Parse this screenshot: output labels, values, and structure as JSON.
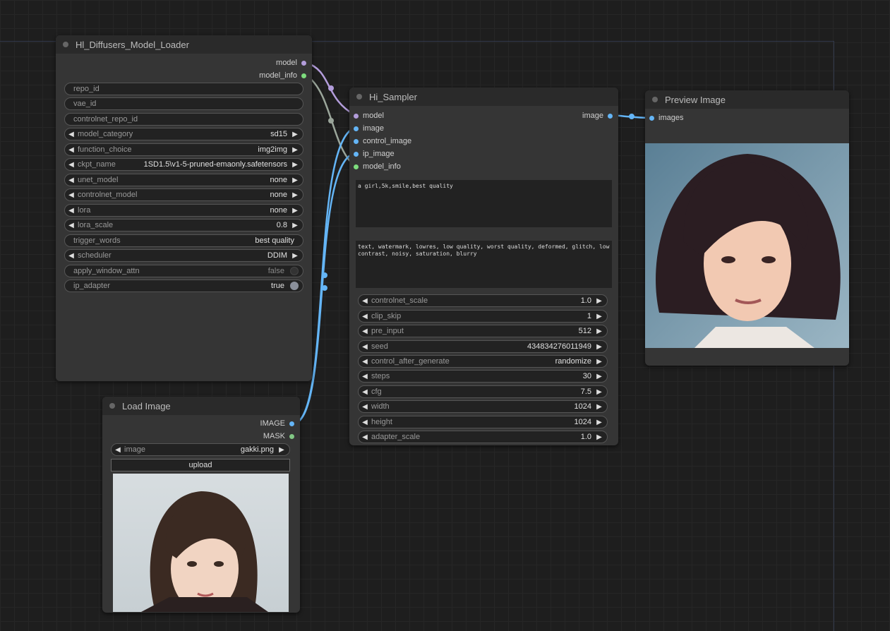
{
  "colors": {
    "model_link": "#b39ddb",
    "model_info_link": "#9aa59a",
    "image_link": "#64b5f6"
  },
  "loader": {
    "title": "Hl_Diffusers_Model_Loader",
    "outputs": {
      "model": "model",
      "model_info": "model_info"
    },
    "widgets": {
      "repo_id": "repo_id",
      "vae_id": "vae_id",
      "controlnet_repo_id": "controlnet_repo_id",
      "model_category": {
        "label": "model_category",
        "value": "sd15"
      },
      "function_choice": {
        "label": "function_choice",
        "value": "img2img"
      },
      "ckpt_name": {
        "label": "ckpt_name",
        "value": "1SD1.5\\v1-5-pruned-emaonly.safetensors"
      },
      "unet_model": {
        "label": "unet_model",
        "value": "none"
      },
      "controlnet_model": {
        "label": "controlnet_model",
        "value": "none"
      },
      "lora": {
        "label": "lora",
        "value": "none"
      },
      "lora_scale": {
        "label": "lora_scale",
        "value": "0.8"
      },
      "trigger_words": {
        "label": "trigger_words",
        "value": "best quality"
      },
      "scheduler": {
        "label": "scheduler",
        "value": "DDIM"
      },
      "apply_window_attn": {
        "label": "apply_window_attn",
        "value": "false"
      },
      "ip_adapter": {
        "label": "ip_adapter",
        "value": "true"
      }
    }
  },
  "load_image": {
    "title": "Load Image",
    "outputs": {
      "image": "IMAGE",
      "mask": "MASK"
    },
    "image_widget": {
      "label": "image",
      "value": "gakki.png"
    },
    "upload_label": "upload"
  },
  "sampler": {
    "title": "Hi_Sampler",
    "inputs": [
      "model",
      "image",
      "control_image",
      "ip_image",
      "model_info"
    ],
    "output": "image",
    "positive_prompt": "a girl,5k,smile,best quality",
    "negative_prompt": "text, watermark, lowres, low quality, worst quality, deformed, glitch, low contrast, noisy, saturation, blurry",
    "widgets": [
      {
        "label": "controlnet_scale",
        "value": "1.0"
      },
      {
        "label": "clip_skip",
        "value": "1"
      },
      {
        "label": "pre_input",
        "value": "512"
      },
      {
        "label": "seed",
        "value": "434834276011949"
      },
      {
        "label": "control_after_generate",
        "value": "randomize"
      },
      {
        "label": "steps",
        "value": "30"
      },
      {
        "label": "cfg",
        "value": "7.5"
      },
      {
        "label": "width",
        "value": "1024"
      },
      {
        "label": "height",
        "value": "1024"
      },
      {
        "label": "adapter_scale",
        "value": "1.0"
      }
    ]
  },
  "preview": {
    "title": "Preview Image",
    "input": "images"
  }
}
